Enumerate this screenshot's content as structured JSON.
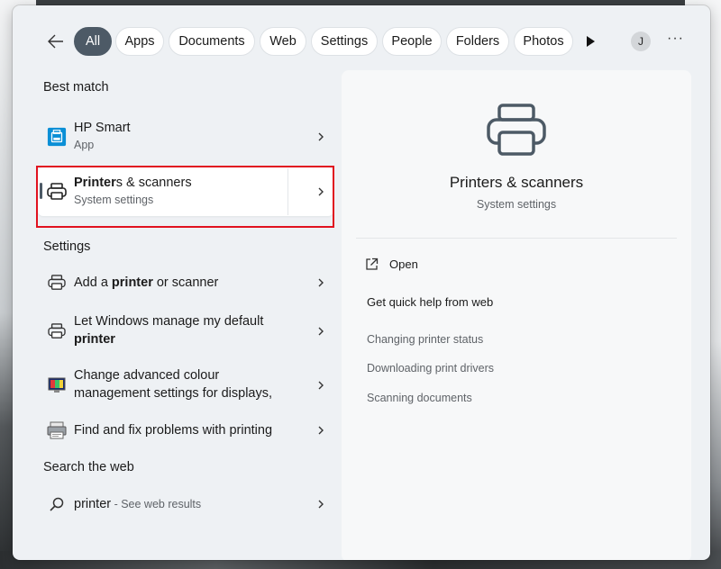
{
  "filters": {
    "back_icon": "arrow-left-icon",
    "tabs": [
      {
        "label": "All",
        "active": true
      },
      {
        "label": "Apps",
        "active": false
      },
      {
        "label": "Documents",
        "active": false
      },
      {
        "label": "Web",
        "active": false
      },
      {
        "label": "Settings",
        "active": false
      },
      {
        "label": "People",
        "active": false
      },
      {
        "label": "Folders",
        "active": false
      },
      {
        "label": "Photos",
        "active": false
      }
    ],
    "avatar_initial": "J",
    "more_label": "···"
  },
  "sections": {
    "best_match": "Best match",
    "settings": "Settings",
    "search_web": "Search the web"
  },
  "best_match": [
    {
      "title": "HP Smart",
      "subtitle": "App",
      "icon": "hp-smart-icon"
    },
    {
      "title_pre": "Printer",
      "title_post": "s & scanners",
      "subtitle": "System settings",
      "icon": "printer-icon",
      "selected": true
    }
  ],
  "settings_results": [
    {
      "pre": "Add a ",
      "bold": "printer",
      "post": " or scanner",
      "icon": "printer-icon"
    },
    {
      "line1": "Let Windows manage my default",
      "line2_bold": "printer",
      "icon": "printer-icon"
    },
    {
      "line1": "Change advanced colour",
      "line2": "management settings for displays,",
      "icon": "color-monitor-icon"
    },
    {
      "text": "Find and fix problems with printing",
      "icon": "troubleshoot-printer-icon"
    }
  ],
  "web_result": {
    "query": "printer",
    "suffix": " - See web results",
    "icon": "search-icon"
  },
  "preview": {
    "title": "Printers & scanners",
    "subtitle": "System settings",
    "open_label": "Open",
    "help_title": "Get quick help from web",
    "help_links": [
      "Changing printer status",
      "Downloading print drivers",
      "Scanning documents"
    ]
  },
  "colors": {
    "accent": "#4d5a66",
    "highlight_box": "#e1121f"
  }
}
